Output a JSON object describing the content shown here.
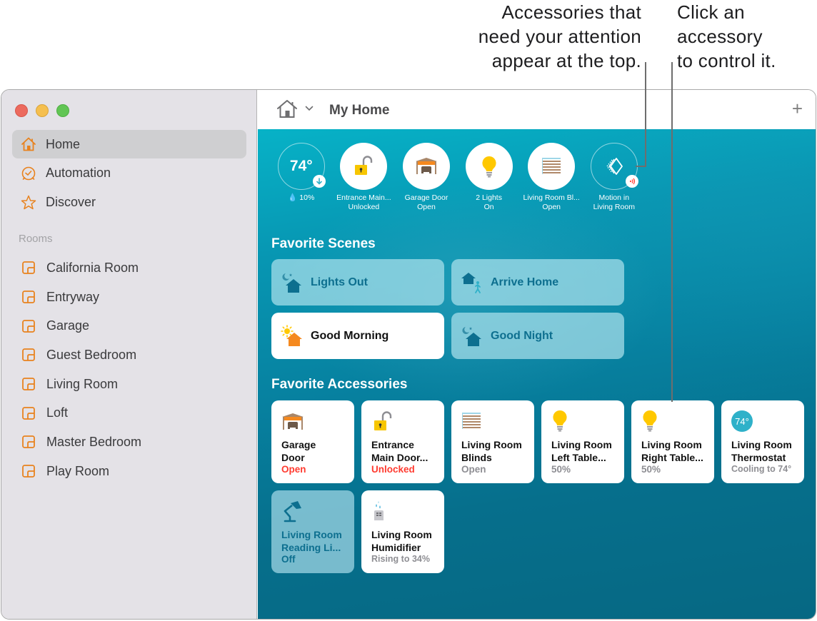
{
  "callouts": {
    "attention": [
      "Accessories that",
      "need your attention",
      "appear at the top."
    ],
    "control": [
      "Click an",
      "accessory",
      "to control it."
    ]
  },
  "sidebar": {
    "nav": [
      {
        "label": "Home",
        "icon": "home-icon",
        "selected": true
      },
      {
        "label": "Automation",
        "icon": "clock-icon",
        "selected": false
      },
      {
        "label": "Discover",
        "icon": "star-icon",
        "selected": false
      }
    ],
    "rooms_label": "Rooms",
    "rooms": [
      "California Room",
      "Entryway",
      "Garage",
      "Guest Bedroom",
      "Living Room",
      "Loft",
      "Master Bedroom",
      "Play Room"
    ]
  },
  "toolbar": {
    "title": "My Home",
    "add_label": "+"
  },
  "status": [
    {
      "value": "74°",
      "label": "💧 10%",
      "icon": "thermostat-icon"
    },
    {
      "line1": "Entrance Main...",
      "line2": "Unlocked",
      "icon": "lock-open-icon"
    },
    {
      "line1": "Garage Door",
      "line2": "Open",
      "icon": "garage-door-icon"
    },
    {
      "line1": "2 Lights",
      "line2": "On",
      "icon": "lightbulb-icon"
    },
    {
      "line1": "Living Room Bl...",
      "line2": "Open",
      "icon": "blinds-icon"
    },
    {
      "line1": "Motion in",
      "line2": "Living Room",
      "icon": "motion-sensor-icon"
    }
  ],
  "scenes": {
    "title": "Favorite Scenes",
    "items": [
      {
        "label": "Lights Out",
        "icon": "night-house-icon",
        "active": false
      },
      {
        "label": "Arrive Home",
        "icon": "arrive-home-icon",
        "active": false
      },
      {
        "label": "Good Morning",
        "icon": "morning-house-icon",
        "active": true
      },
      {
        "label": "Good Night",
        "icon": "night-house-icon",
        "active": false
      }
    ]
  },
  "accessories": {
    "title": "Favorite Accessories",
    "items": [
      {
        "name": "Garage\nDoor",
        "status": "Open",
        "alert": true,
        "icon": "garage-door-icon"
      },
      {
        "name": "Entrance\nMain Door...",
        "status": "Unlocked",
        "alert": true,
        "icon": "lock-open-icon"
      },
      {
        "name": "Living Room\nBlinds",
        "status": "Open",
        "alert": false,
        "icon": "blinds-icon"
      },
      {
        "name": "Living Room\nLeft Table...",
        "status": "50%",
        "alert": false,
        "icon": "lightbulb-icon"
      },
      {
        "name": "Living Room\nRight Table...",
        "status": "50%",
        "alert": false,
        "icon": "lightbulb-icon"
      },
      {
        "name": "Living Room\nThermostat",
        "status": "Cooling to 74°",
        "alert": false,
        "icon": "thermostat-icon",
        "badge": "74°"
      },
      {
        "name": "Living Room\nReading Li...",
        "status": "Off",
        "alert": false,
        "off": true,
        "icon": "desk-lamp-icon"
      },
      {
        "name": "Living Room\nHumidifier",
        "status": "Rising to 34%",
        "alert": false,
        "icon": "humidifier-icon"
      }
    ]
  },
  "colors": {
    "accent": "#e8821e",
    "alert": "#ff3b30",
    "teal": "#0d6f8f"
  }
}
